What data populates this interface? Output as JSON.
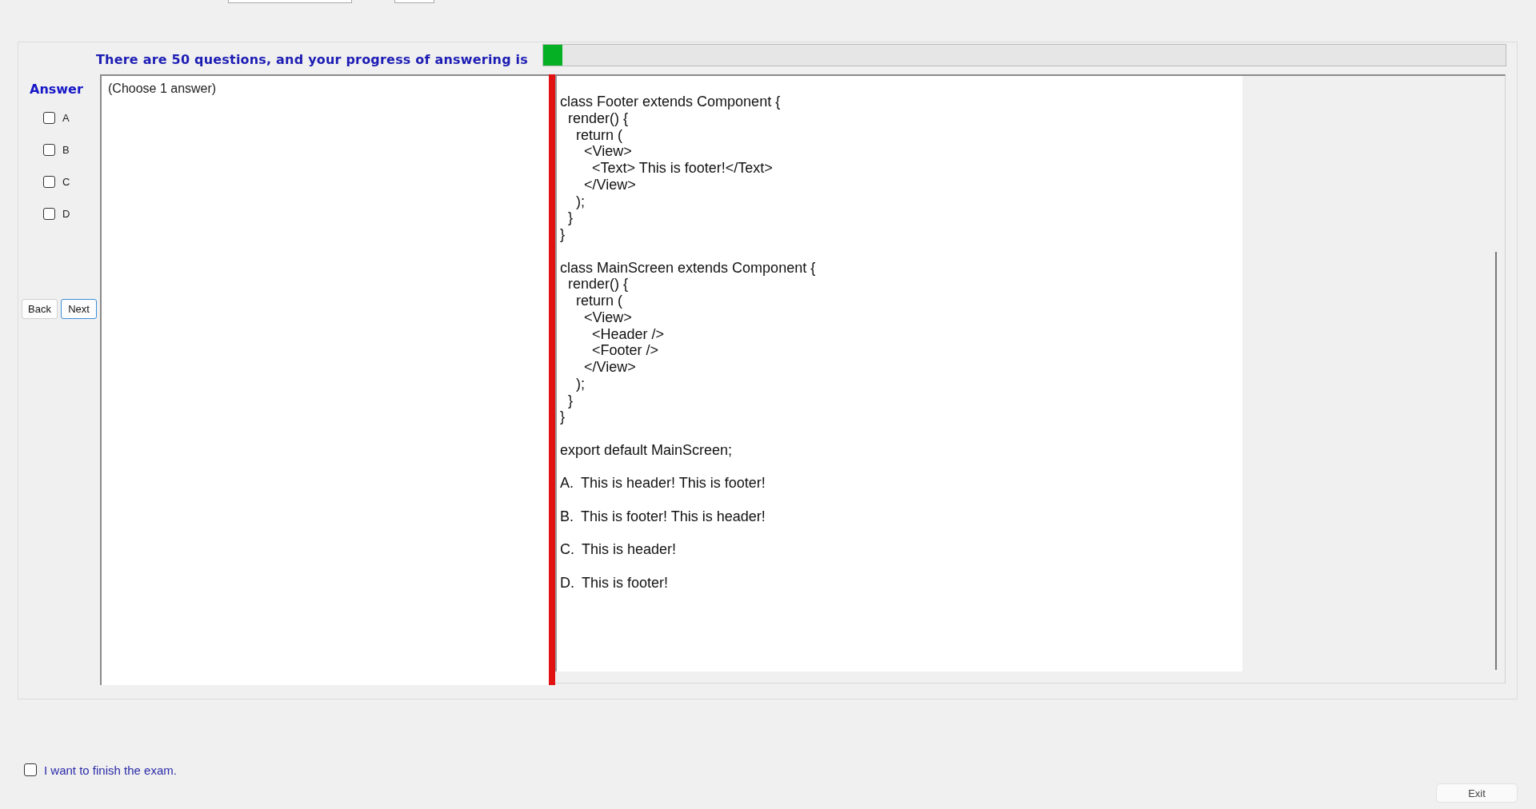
{
  "progress": {
    "text": "There are 50 questions, and your progress of answering is",
    "level": 0.02
  },
  "answer_panel": {
    "title": "Answer",
    "choices": [
      {
        "label": "A",
        "checked": false
      },
      {
        "label": "B",
        "checked": false
      },
      {
        "label": "C",
        "checked": false
      },
      {
        "label": "D",
        "checked": false
      }
    ],
    "buttons": [
      {
        "label": "Back",
        "focused": false
      },
      {
        "label": "Next",
        "focused": true
      }
    ]
  },
  "question": {
    "instruction": "(Choose 1 answer)",
    "code_blocks": [
      [
        "class Footer extends Component {",
        "  render() {",
        "    return (",
        "      <View>",
        "        <Text> This is footer!</Text>",
        "      </View>",
        "    );",
        "  }",
        "}"
      ],
      [
        "class MainScreen extends Component {",
        "  render() {",
        "    return (",
        "      <View>",
        "        <Header />",
        "        <Footer />",
        "      </View>",
        "    );",
        "  }",
        "}"
      ],
      [
        "export default MainScreen;"
      ]
    ],
    "options": [
      {
        "letter": "A.",
        "text": "This is header! This is footer!"
      },
      {
        "letter": "B.",
        "text": "This is footer! This is header!"
      },
      {
        "letter": "C.",
        "text": "This is header!"
      },
      {
        "letter": "D.",
        "text": "This is footer!"
      }
    ]
  },
  "finish": {
    "label": "I want to finish the exam.",
    "checked": false
  },
  "exit_button": {
    "label": "Exit"
  }
}
